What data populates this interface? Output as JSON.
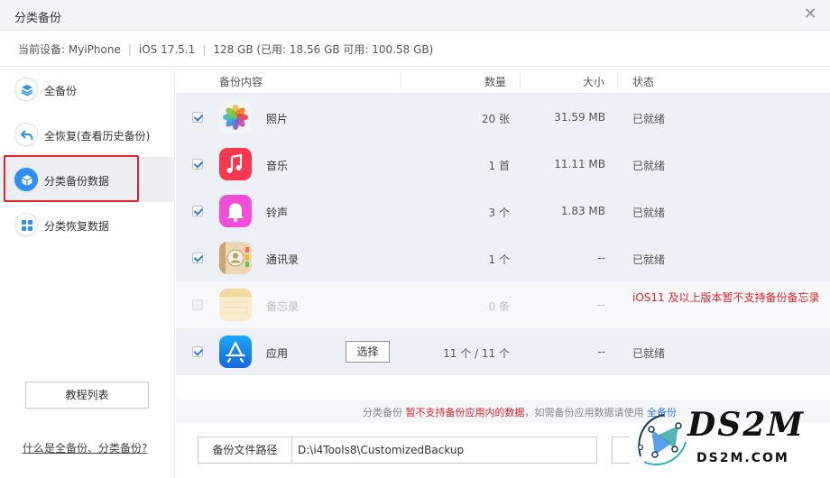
{
  "window": {
    "title": "分类备份",
    "close_label": "✕"
  },
  "device": {
    "prefix": "当前设备: ",
    "name": "MyiPhone",
    "ios": "iOS 17.5.1",
    "storage": "128 GB (已用: 18.56 GB 可用: 100.58 GB)",
    "sep": "|"
  },
  "sidebar": {
    "items": [
      {
        "label": "全备份",
        "icon": "layers-icon"
      },
      {
        "label": "全恢复(查看历史备份)",
        "icon": "undo-arrow-icon"
      },
      {
        "label": "分类备份数据",
        "icon": "cube-icon",
        "active": true
      },
      {
        "label": "分类恢复数据",
        "icon": "grid-icon"
      }
    ],
    "tutorial_label": "教程列表",
    "help_link": "什么是全备份、分类备份?"
  },
  "table": {
    "headers": {
      "content": "备份内容",
      "count": "数量",
      "size": "大小",
      "status": "状态"
    },
    "rows": [
      {
        "name": "照片",
        "count": "20 张",
        "size": "31.59 MB",
        "status": "已就绪",
        "checked": true,
        "icon": "photos-app-icon"
      },
      {
        "name": "音乐",
        "count": "1 首",
        "size": "11.11 MB",
        "status": "已就绪",
        "checked": true,
        "icon": "music-app-icon"
      },
      {
        "name": "铃声",
        "count": "3 个",
        "size": "1.83 MB",
        "status": "已就绪",
        "checked": true,
        "icon": "ringtone-bell-icon"
      },
      {
        "name": "通讯录",
        "count": "1 个",
        "size": "--",
        "status": "已就绪",
        "checked": true,
        "icon": "contacts-app-icon"
      },
      {
        "name": "备忘录",
        "count": "0 条",
        "size": "--",
        "status": "iOS11 及以上版本暂不支持备份备忘录",
        "checked": false,
        "disabled": true,
        "icon": "notes-app-icon"
      },
      {
        "name": "应用",
        "count": "11 个 / 11 个",
        "size": "--",
        "status": "已就绪",
        "checked": true,
        "icon": "app-store-icon",
        "select_label": "选择"
      }
    ]
  },
  "notice": {
    "part1": "分类备份 ",
    "red": "暂不支持备份应用内的数据",
    "part2": "，如需备份应用数据请使用 ",
    "link": "全备份"
  },
  "path": {
    "label": "备份文件路径",
    "value": "D:\\i4Tools8\\CustomizedBackup"
  },
  "watermark": {
    "logo_text": "DS2M",
    "sub_text": "DS2M.COM"
  },
  "colors": {
    "accent": "#2f8ff5",
    "warning": "#e0242b",
    "highlight_frame": "#e0242b"
  }
}
